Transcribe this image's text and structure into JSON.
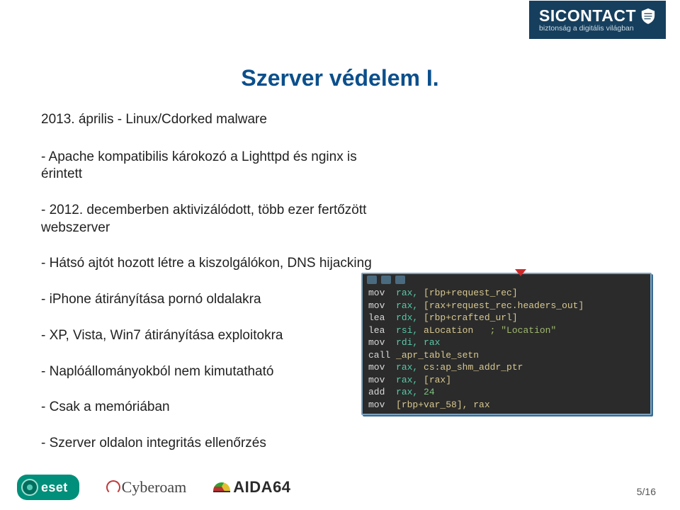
{
  "header": {
    "brand": "SICONTACT",
    "tagline": "biztonság a digitális világban"
  },
  "title": "Szerver védelem I.",
  "intro": "2013. április - Linux/Cdorked malware",
  "bullets": [
    "- Apache kompatibilis károkozó a Lighttpd és nginx is érintett",
    "- 2012. decemberben aktivizálódott, több ezer fertőzött webszerver",
    "- Hátsó ajtót hozott létre a kiszolgálókon, DNS hijacking",
    "- iPhone átirányítása pornó oldalakra",
    "- XP, Vista, Win7 átirányítása exploitokra",
    "- Naplóállományokból nem kimutatható",
    "- Csak a memóriában",
    "- Szerver oldalon integritás ellenőrzés"
  ],
  "asm_lines": [
    {
      "m": "mov",
      "a": "rax, ",
      "b": "[rbp+request_rec]"
    },
    {
      "m": "mov",
      "a": "rax, ",
      "b": "[rax+request_rec.headers_out]"
    },
    {
      "m": "lea",
      "a": "rdx, ",
      "b": "[rbp+crafted_url]"
    },
    {
      "m": "lea",
      "a": "rsi, ",
      "b": "aLocation",
      "c": "   ; \"Location\""
    },
    {
      "m": "mov",
      "a": "rdi, ",
      "b": "rax"
    },
    {
      "m": "call",
      "a": "",
      "b": "_apr_table_setn"
    },
    {
      "m": "mov",
      "a": "rax, ",
      "b": "cs:ap_shm_addr_ptr"
    },
    {
      "m": "mov",
      "a": "rax, ",
      "b": "[rax]"
    },
    {
      "m": "add",
      "a": "rax, ",
      "b": "24"
    },
    {
      "m": "mov",
      "a": "",
      "b": "[rbp+var_58], rax"
    }
  ],
  "footer": {
    "eset": "eset",
    "cyberoam": "Cyberoam",
    "aida": "AIDA64",
    "page": "5/16"
  }
}
